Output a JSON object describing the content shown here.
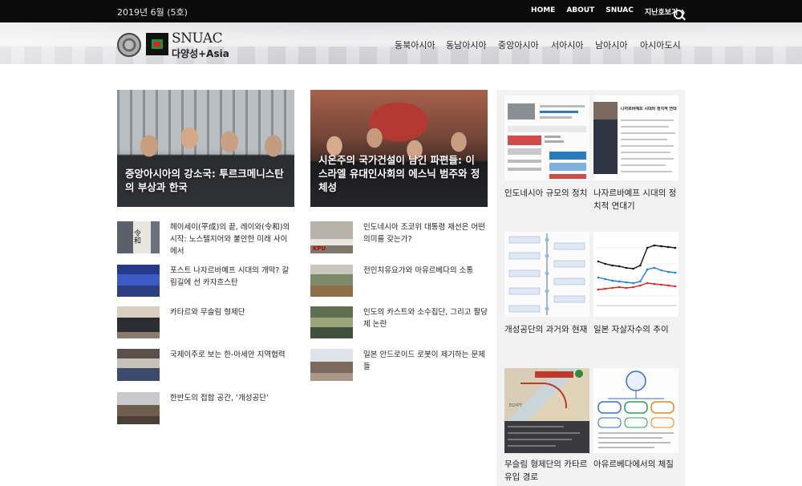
{
  "topbar": {
    "date": "2019년 6월 (5호)",
    "nav": [
      "HOME",
      "ABOUT",
      "SNUAC",
      "지난호보기"
    ]
  },
  "brand": {
    "line1": "SNUAC",
    "line2": "다양성+Asia"
  },
  "regions": [
    "동북아시아",
    "동남아시아",
    "중앙아시아",
    "서아시아",
    "남아시아",
    "아시아도시"
  ],
  "featured": [
    {
      "title": "중앙아시아의 강소국: 투르크메니스탄의 부상과 한국"
    },
    {
      "title": "시온주의 국가건설이 남긴 파편들: 이스라엘 유대인사회의 에스닉 범주와 정체성"
    }
  ],
  "list_left": [
    {
      "title": "헤이세이(平成)의 끝, 레이와(令和)의 시작: 노스텔지어와 불안한 미래 사이에서",
      "thumb_text": "令和"
    },
    {
      "title": "포스트 나자르바예프 시대의 개막? 갈림길에 선 카자흐스탄"
    },
    {
      "title": "카타르와 무슬림 형제단"
    },
    {
      "title": "국제이주로 보는 한-아세안 지역협력"
    },
    {
      "title": "한반도의 접합 공간, ‘개성공단’"
    }
  ],
  "list_right": [
    {
      "title": "인도네시아 조코위 대통령 재선은 어떤 의미를 갖는가?",
      "thumb_text": "KPU"
    },
    {
      "title": "전인치유요가와 아유르베다의 소통"
    },
    {
      "title": "인도의 카스트와 소수집단, 그리고 팔당제 논란"
    },
    {
      "title": "일본 안드로이드 로봇이 제기하는 문제들"
    }
  ],
  "sidebar_cards": [
    {
      "title": "인도네시아 규모의 정치"
    },
    {
      "title": "나자르바예프 시대의 정치적 연대기",
      "img_heading": "나자르바예프 시대의 정치적 연대"
    },
    {
      "title": "개성공단의 과거와 현재"
    },
    {
      "title": "일본 자살자수의 추이"
    },
    {
      "title": "무슬림 형제단의 카타르 유입 경로",
      "img_text": "EGYPT"
    },
    {
      "title": "아유르베다에서의 체질"
    }
  ],
  "colors": {
    "topbar_bg": "#0b0b0b",
    "sidebar_bg": "#f2f2f2"
  },
  "chart_data": {
    "type": "line",
    "series": [
      {
        "values": [
          0.55,
          0.52,
          0.5,
          0.49,
          0.47,
          0.46,
          0.5,
          0.72,
          0.75,
          0.74,
          0.73,
          0.72
        ]
      },
      {
        "values": [
          0.35,
          0.33,
          0.31,
          0.3,
          0.29,
          0.28,
          0.3,
          0.45,
          0.47,
          0.44,
          0.42,
          0.41
        ]
      },
      {
        "values": [
          0.2,
          0.21,
          0.22,
          0.23,
          0.22,
          0.23,
          0.25,
          0.28,
          0.27,
          0.26,
          0.25,
          0.24
        ]
      }
    ],
    "colors": [
      "#111111",
      "#1e7fd6",
      "#d62828"
    ]
  }
}
